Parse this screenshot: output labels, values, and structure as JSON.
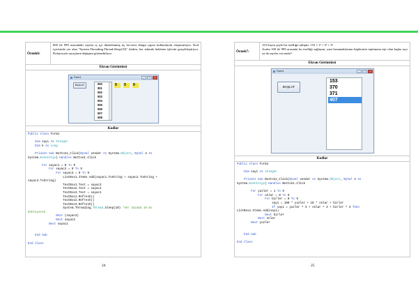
{
  "pages": [
    {
      "number": "24",
      "example_label": "Örnek6:",
      "example_text": "000 ile 999 arasındaki sayılar iç içe düzenlenmiş üç for-next döngü yapısı kullanılarak oluşturuluyor. Kod içerisinde yer alan \"System.Threading.Thread.Sleep(10)\" ifadesi, her adımda bekleme işlevini gerçekleştiriyor. Dolayısıyla sayaçların değişimi görünebiliyor.",
      "screen_heading": "Ekran Görüntüsü",
      "window": {
        "title": "Form1",
        "button_label": "BAŞLAT",
        "list_items": [
          "000",
          "001",
          "002",
          "003",
          "004",
          "005",
          "006",
          "007",
          "008"
        ],
        "digits": [
          "9",
          "9",
          "9"
        ]
      },
      "code_heading": "Kodlar",
      "code_lines": [
        "Public Class Form1",
        "",
        "    Dim sayı As Integer",
        "    Dim k As Long",
        "",
        "    Private Sub Button1_Click(ByVal sender As System.Object, ByVal e As",
        "System.EventArgs) Handles Button1.Click",
        "",
        "        For sayac1 = 0 To 9",
        "            For sayac2 = 0 To 9",
        "                For sayac3 = 0 To 9",
        "                    ListBox1.Items.Add(sayac1.ToString + sayac2.ToString +",
        "sayac3.ToString)",
        "                    TextBox1.Text = sayac3",
        "                    TextBox2.Text = sayac2",
        "                    TextBox3.Text = sayac1",
        "                    TextBox1.Refresh()",
        "                    TextBox2.Refresh()",
        "                    TextBox3.Refresh()",
        "                    System.Threading.Thread.Sleep(10) 'Her adımda 10 ms",
        "bekleyecek.",
        "                Next (sayac3)",
        "                Next sayac2",
        "            Next sayac1",
        "",
        "",
        "    End Sub",
        "",
        "End Class"
      ]
    },
    {
      "number": "25",
      "example_label": "Örnek7:",
      "example_text_1": "153 Sayısı şöyle bir özelliğe sahiptir:  153 = 1³ + 5³ + 3³",
      "example_text_2": "Acaba 100 ile 999 arasında bu özelliği sağlayan, yani basamaklarının küplerinin toplamına eşit olan başka sayı ya da sayılar var mıdır?",
      "screen_heading": "Ekran Görüntüsü",
      "window": {
        "title": "Form1",
        "button_label": "BAŞLAT",
        "list_items": [
          "153",
          "370",
          "371",
          "407"
        ]
      },
      "code_heading": "Kodlar",
      "code_lines": [
        "Public Class Form1",
        "",
        "    Dim sayi As Integer",
        "",
        "    Private Sub Button1_Click(ByVal sender As System.Object, ByVal e As",
        "System.EventArgs) Handles Button1.Click",
        "",
        "        For yuzler = 1 To 9",
        "            For onlar = 0 To 9",
        "                For birler = 0 To 9",
        "                    sayi = 100 * yuzler + 10 * onlar + birler",
        "                    If sayi = yuzler ^ 3 + onlar ^ 3 + birler ^ 3 Then",
        "ListBox1.Items.Add(sayi)",
        "                Next birler",
        "            Next onlar",
        "        Next yuzler",
        "",
        "",
        "    End Sub",
        "",
        "End Class"
      ]
    }
  ]
}
